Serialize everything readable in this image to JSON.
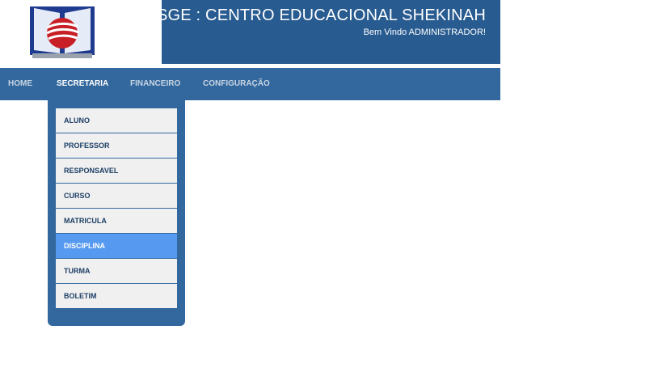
{
  "header": {
    "title": "SGE : CENTRO EDUCACIONAL SHEKINAH",
    "welcome": "Bem Vindo ADMINISTRADOR!",
    "logo_icon": "open-book-globe-logo",
    "colors": {
      "header_bg": "#285b90",
      "nav_bg": "#33689e"
    }
  },
  "nav": {
    "home": "HOME",
    "secretaria": "SECRETARIA",
    "financeiro": "FINANCEIRO",
    "configuracao": "CONFIGURAÇÃO",
    "active": "SECRETARIA"
  },
  "dropdown": {
    "items": [
      "ALUNO",
      "PROFESSOR",
      "RESPONSAVEL",
      "CURSO",
      "MATRICULA",
      "DISCIPLINA",
      "TURMA",
      "BOLETIM"
    ],
    "highlighted": "DISCIPLINA",
    "highlight_color": "#5599f0"
  }
}
